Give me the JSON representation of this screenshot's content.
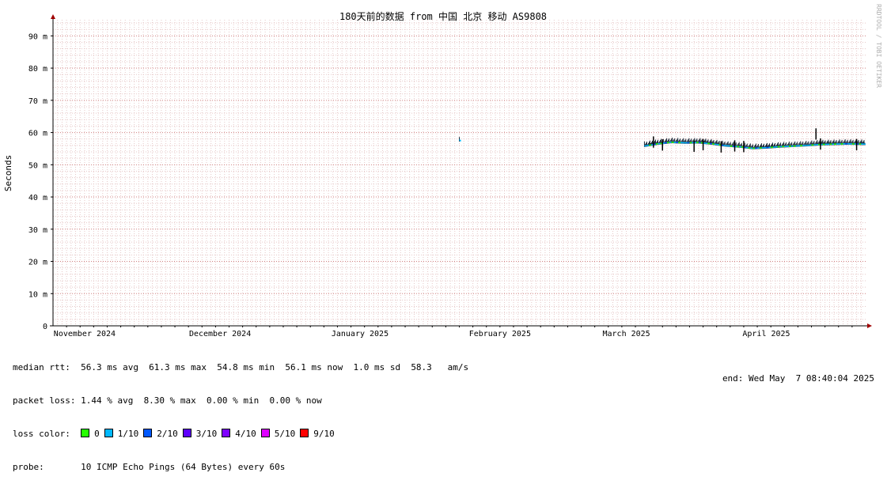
{
  "chart_data": {
    "type": "line",
    "title": "180天前的数据 from 中国 北京 移动 AS9808",
    "ylabel": "Seconds",
    "watermark": "RRDTOOL / TOBI OETIKER",
    "ylim": [
      0,
      95
    ],
    "y_ticks": [
      {
        "value": 0,
        "label": "0"
      },
      {
        "value": 10,
        "label": "10 m"
      },
      {
        "value": 20,
        "label": "20 m"
      },
      {
        "value": 30,
        "label": "30 m"
      },
      {
        "value": 40,
        "label": "40 m"
      },
      {
        "value": 50,
        "label": "50 m"
      },
      {
        "value": 60,
        "label": "60 m"
      },
      {
        "value": 70,
        "label": "70 m"
      },
      {
        "value": 80,
        "label": "80 m"
      },
      {
        "value": 90,
        "label": "90 m"
      }
    ],
    "x_start": "2024-11-08",
    "x_end": "2025-05-07",
    "x_ticks": [
      {
        "date": "2024-11-15",
        "label": "November 2024"
      },
      {
        "date": "2024-12-15",
        "label": "December 2024"
      },
      {
        "date": "2025-01-15",
        "label": "January 2025"
      },
      {
        "date": "2025-02-15",
        "label": "February 2025"
      },
      {
        "date": "2025-03-15",
        "label": "March 2025"
      },
      {
        "date": "2025-04-15",
        "label": "April 2025"
      }
    ],
    "grid": true,
    "series": [
      {
        "name": "median rtt",
        "color": "#00cc00",
        "points": [
          [
            "2025-02-06",
            57.8
          ],
          [
            "2025-03-19",
            55.8
          ],
          [
            "2025-03-22",
            56.5
          ],
          [
            "2025-03-25",
            57.0
          ],
          [
            "2025-03-28",
            56.8
          ],
          [
            "2025-03-31",
            56.9
          ],
          [
            "2025-04-03",
            56.5
          ],
          [
            "2025-04-06",
            55.9
          ],
          [
            "2025-04-09",
            55.6
          ],
          [
            "2025-04-12",
            55.1
          ],
          [
            "2025-04-15",
            55.3
          ],
          [
            "2025-04-18",
            55.6
          ],
          [
            "2025-04-21",
            55.8
          ],
          [
            "2025-04-24",
            56.0
          ],
          [
            "2025-04-27",
            56.3
          ],
          [
            "2025-04-30",
            56.4
          ],
          [
            "2025-05-03",
            56.5
          ],
          [
            "2025-05-07",
            56.4
          ]
        ]
      }
    ],
    "spikes": [
      [
        "2025-03-21",
        58.8
      ],
      [
        "2025-03-23",
        57.9
      ],
      [
        "2025-03-30",
        57.5
      ],
      [
        "2025-04-01",
        58.0
      ],
      [
        "2025-04-05",
        57.3
      ],
      [
        "2025-04-08",
        57.6
      ],
      [
        "2025-04-10",
        57.4
      ],
      [
        "2025-04-26",
        61.3
      ],
      [
        "2025-04-27",
        58.2
      ],
      [
        "2025-05-05",
        58.0
      ]
    ]
  },
  "legend": {
    "median_rtt": "median rtt:  56.3 ms avg  61.3 ms max  54.8 ms min  56.1 ms now  1.0 ms sd  58.3   am/s",
    "packet_loss": "packet loss: 1.44 % avg  8.30 % max  0.00 % min  0.00 % now",
    "loss_color_label": "loss color:",
    "loss_colors": [
      {
        "label": "0",
        "color": "#26ff00"
      },
      {
        "label": "1/10",
        "color": "#00b8ff"
      },
      {
        "label": "2/10",
        "color": "#0059ff"
      },
      {
        "label": "3/10",
        "color": "#5e00ff"
      },
      {
        "label": "4/10",
        "color": "#7e00ff"
      },
      {
        "label": "5/10",
        "color": "#dd00ff"
      },
      {
        "label": "9/10",
        "color": "#ff0000"
      }
    ],
    "probe": "probe:       10 ICMP Echo Pings (64 Bytes) every 60s",
    "end": "end: Wed May  7 08:40:04 2025"
  }
}
